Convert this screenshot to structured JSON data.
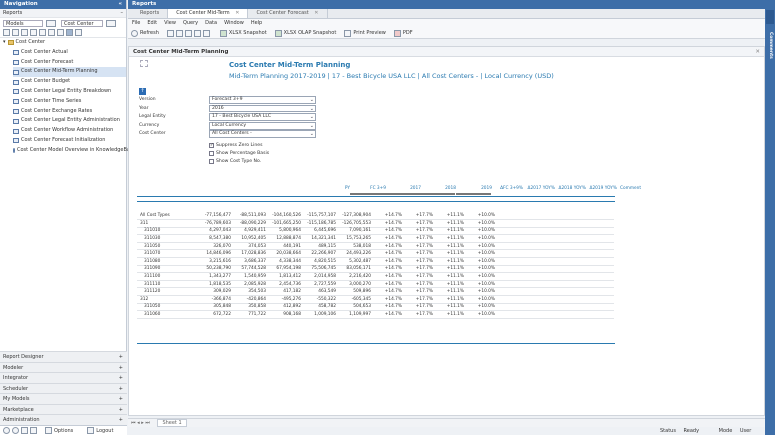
{
  "nav": {
    "header": "Navigation",
    "section": "Reports",
    "models_select": "Models",
    "model_select": "Cost Center",
    "tree_root": "Cost Center",
    "items": [
      "Cost Center Actual",
      "Cost Center Forecast",
      "Cost Center Mid-Term Planning",
      "Cost Center Budget",
      "Cost Center Legal Entity Breakdown",
      "Cost Center Time Series",
      "Cost Center Exchange Rates",
      "Cost Center Legal Entity Administration",
      "Cost Center Workflow Administration",
      "Cost Center Forecast Initialization",
      "Cost Center Model Overview in KnowledgeBase"
    ],
    "categories": [
      "Report Designer",
      "Modeler",
      "Integrator",
      "Scheduler",
      "My Models",
      "Marketplace",
      "Administration"
    ],
    "options_label": "Options",
    "logout_label": "Logout"
  },
  "reports_header": "Reports",
  "tabs": [
    "Reports",
    "Cost Center Mid-Term",
    "Cost Center Forecast"
  ],
  "menu": [
    "File",
    "Edit",
    "View",
    "Query",
    "Data",
    "Window",
    "Help"
  ],
  "toolbar": {
    "refresh": "Refresh",
    "xlsx": "XLSX Snapshot",
    "olap": "XLSX OLAP Snapshot",
    "print": "Print Preview",
    "pdf": "PDF"
  },
  "sheet_title": "Cost Center Mid-Term Planning",
  "report": {
    "title": "Cost Center Mid-Term Planning",
    "subtitle": "Mid-Term Planning 2017-2019 | 17 - Best Bicycle USA LLC | All Cost Centers - | Local Currency (USD)"
  },
  "params": [
    {
      "label": "Version",
      "value": "Forecast 3+9"
    },
    {
      "label": "Year",
      "value": "2016"
    },
    {
      "label": "Legal Entity",
      "value": "17 - Best Bicycle USA LLC"
    },
    {
      "label": "Currency",
      "value": "Local Currency"
    },
    {
      "label": "Cost Center",
      "value": "All Cost Centers -"
    }
  ],
  "checks": [
    {
      "label": "Suppress Zero Lines",
      "checked": true
    },
    {
      "label": "Show Percentage Basis",
      "checked": false
    },
    {
      "label": "Show Cost Type No.",
      "checked": false
    }
  ],
  "columns": [
    "PY",
    "FC 3+9",
    "2017",
    "2018",
    "2019",
    "ΔFC 3+9%",
    "Δ2017 YOY%",
    "Δ2018 YOY%",
    "Δ2019 YOY%",
    "Comment"
  ],
  "rows": [
    {
      "label": "All Cost Types",
      "v": [
        "-77,156,477",
        "-88,511,093",
        "-104,160,526",
        "-115,757,107",
        "-127,308,904",
        "+14.7%",
        "+17.7%",
        "+11.1%",
        "+10.0%"
      ]
    },
    {
      "label": "311",
      "v": [
        "-76,789,603",
        "-88,090,229",
        "-101,665,250",
        "-115,186,785",
        "-126,705,553",
        "+14.7%",
        "+17.7%",
        "+11.1%",
        "+10.0%"
      ]
    },
    {
      "label": "311010",
      "v": [
        "4,297,043",
        "4,929,411",
        "5,800,964",
        "6,445,696",
        "7,090,161",
        "+14.7%",
        "+17.7%",
        "+11.1%",
        "+10.0%"
      ]
    },
    {
      "label": "311030",
      "v": [
        "8,547,380",
        "10,952,405",
        "12,888,874",
        "14,321,341",
        "15,753,265",
        "+14.7%",
        "+17.7%",
        "+11.1%",
        "+10.0%"
      ]
    },
    {
      "label": "311050",
      "v": [
        "326,070",
        "374,053",
        "440,191",
        "489,115",
        "538,018",
        "+14.7%",
        "+17.7%",
        "+11.1%",
        "+10.0%"
      ]
    },
    {
      "label": "311070",
      "v": [
        "14,846,096",
        "17,028,836",
        "20,038,664",
        "22,266,907",
        "24,493,226",
        "+14.7%",
        "+17.7%",
        "+11.1%",
        "+10.0%"
      ]
    },
    {
      "label": "311080",
      "v": [
        "3,215,616",
        "3,686,337",
        "4,338,344",
        "4,820,515",
        "5,302,487",
        "+14.7%",
        "+17.7%",
        "+11.1%",
        "+10.0%"
      ]
    },
    {
      "label": "311090",
      "v": [
        "50,238,790",
        "57,744,528",
        "67,954,198",
        "75,506,745",
        "83,056,171",
        "+14.7%",
        "+17.7%",
        "+11.1%",
        "+10.0%"
      ]
    },
    {
      "label": "311100",
      "v": [
        "1,343,277",
        "1,540,959",
        "1,813,412",
        "2,014,958",
        "2,216,420",
        "+14.7%",
        "+17.7%",
        "+11.1%",
        "+10.0%"
      ]
    },
    {
      "label": "311110",
      "v": [
        "1,818,535",
        "2,085,928",
        "2,454,736",
        "2,727,559",
        "3,000,270",
        "+14.7%",
        "+17.7%",
        "+11.1%",
        "+10.0%"
      ]
    },
    {
      "label": "311120",
      "v": [
        "309,029",
        "354,503",
        "417,182",
        "463,549",
        "509,896",
        "+14.7%",
        "+17.7%",
        "+11.1%",
        "+10.0%"
      ]
    },
    {
      "label": "312",
      "v": [
        "-366,874",
        "-420,864",
        "-495,276",
        "-550,322",
        "-605,345",
        "+14.7%",
        "+17.7%",
        "+11.1%",
        "+10.0%"
      ]
    },
    {
      "label": "311050",
      "v": [
        "305,848",
        "350,858",
        "412,892",
        "458,782",
        "504,653",
        "+14.7%",
        "+17.7%",
        "+11.1%",
        "+10.0%"
      ]
    },
    {
      "label": "311060",
      "v": [
        "672,722",
        "771,722",
        "908,168",
        "1,009,106",
        "1,109,997",
        "+14.7%",
        "+17.7%",
        "+11.1%",
        "+10.0%"
      ]
    }
  ],
  "sheet_tab": "Sheet 1",
  "comments_label": "Comments",
  "status": {
    "status": "Status",
    "ready": "Ready",
    "mode": "Mode",
    "user": "User"
  }
}
